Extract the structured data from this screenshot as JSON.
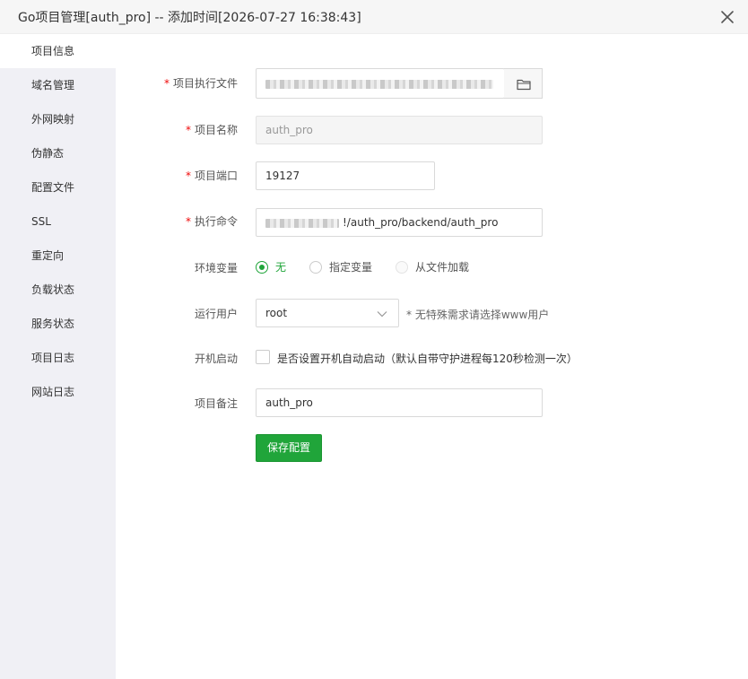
{
  "window": {
    "title": "Go项目管理[auth_pro] -- 添加时间[2026-07-27 16:38:43]"
  },
  "sidebar": {
    "items": [
      {
        "label": "项目信息"
      },
      {
        "label": "域名管理"
      },
      {
        "label": "外网映射"
      },
      {
        "label": "伪静态"
      },
      {
        "label": "配置文件"
      },
      {
        "label": "SSL"
      },
      {
        "label": "重定向"
      },
      {
        "label": "负载状态"
      },
      {
        "label": "服务状态"
      },
      {
        "label": "项目日志"
      },
      {
        "label": "网站日志"
      }
    ],
    "active_index": 0
  },
  "form": {
    "required_mark": "*",
    "exec_file": {
      "label": "项目执行文件",
      "value_visible": ""
    },
    "project_name": {
      "label": "项目名称",
      "value": "auth_pro"
    },
    "project_port": {
      "label": "项目端口",
      "value": "19127"
    },
    "exec_command": {
      "label": "执行命令",
      "value_visible": "!/auth_pro/backend/auth_pro"
    },
    "env": {
      "label": "环境变量",
      "options": [
        {
          "label": "无",
          "checked": true
        },
        {
          "label": "指定变量",
          "checked": false
        },
        {
          "label": "从文件加载",
          "checked": false
        }
      ]
    },
    "run_user": {
      "label": "运行用户",
      "value": "root",
      "hint": "* 无特殊需求请选择www用户"
    },
    "autostart": {
      "label": "开机启动",
      "checkbox_text": "是否设置开机自动启动（默认自带守护进程每120秒检测一次）",
      "checked": false
    },
    "remark": {
      "label": "项目备注",
      "value": "auth_pro"
    },
    "save_label": "保存配置"
  },
  "colors": {
    "accent": "#20a53a",
    "required": "#ef0808",
    "sidebar_bg": "#f0f0f5"
  }
}
